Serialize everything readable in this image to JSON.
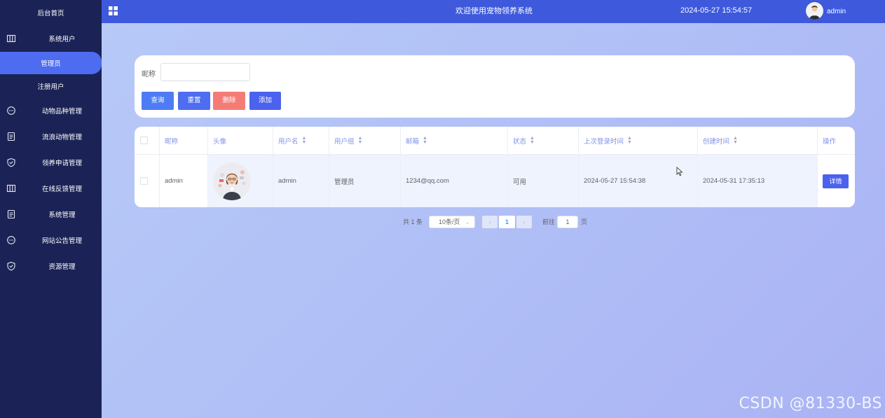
{
  "sidebar": {
    "items": [
      {
        "label": "后台首页",
        "icon": "none"
      },
      {
        "label": "系统用户",
        "icon": "columns-icon"
      },
      {
        "label": "管理员",
        "icon": "none"
      },
      {
        "label": "注册用户",
        "icon": "none"
      },
      {
        "label": "动物品种管理",
        "icon": "chat-icon"
      },
      {
        "label": "流浪动物管理",
        "icon": "document-icon"
      },
      {
        "label": "领养申请管理",
        "icon": "shield-check-icon"
      },
      {
        "label": "在线反馈管理",
        "icon": "columns-icon"
      },
      {
        "label": "系统管理",
        "icon": "document-icon"
      },
      {
        "label": "网站公告管理",
        "icon": "chat-icon"
      },
      {
        "label": "资源管理",
        "icon": "shield-check-icon"
      }
    ],
    "active": "管理员"
  },
  "topbar": {
    "title": "欢迎使用宠物领养系统",
    "datetime": "2024-05-27 15:54:57",
    "username": "admin"
  },
  "search": {
    "label": "昵称",
    "value": "",
    "buttons": {
      "query": "查询",
      "reset": "重置",
      "delete": "删除",
      "add": "添加"
    }
  },
  "table": {
    "headers": [
      "昵称",
      "头像",
      "用户名",
      "用户组",
      "邮箱",
      "状态",
      "上次登录时间",
      "创建时间",
      "操作"
    ],
    "rows": [
      {
        "nickname": "admin",
        "username": "admin",
        "group": "管理员",
        "email": "1234@qq.com",
        "status": "可用",
        "last_login": "2024-05-27 15:54:38",
        "created": "2024-05-31 17:35:13",
        "action": "详情"
      }
    ]
  },
  "pagination": {
    "total": "共 1 条",
    "page_size": "10条/页",
    "current_page": "1",
    "goto_label": "前往",
    "goto_value": "1",
    "page_suffix": "页"
  },
  "watermark": "CSDN @81330-BS",
  "colors": {
    "sidebar_bg": "#1b2356",
    "topbar_bg": "#3e59dc",
    "accent": "#4b62ee",
    "danger": "#f47c76"
  }
}
